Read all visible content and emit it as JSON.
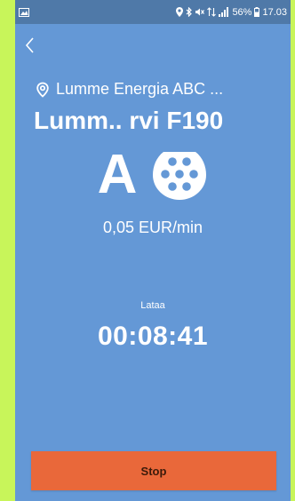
{
  "statusbar": {
    "left_icon": "image-notification-icon",
    "battery": "56%",
    "time": "17.03",
    "icons": [
      "location-icon",
      "bluetooth-icon",
      "mute-icon",
      "data-icon",
      "signal-icon",
      "battery-icon"
    ]
  },
  "header": {
    "back_icon": "chevron-left-icon",
    "location_icon": "map-pin-icon",
    "operator": "Lumme Energia ABC ...",
    "station_title": "Lumm.. rvi F190"
  },
  "connector": {
    "letter": "A",
    "type_icon": "type2-connector-icon"
  },
  "price": "0,05 EUR/min",
  "charging": {
    "status_label": "Lataa",
    "elapsed": "00:08:41"
  },
  "actions": {
    "stop_label": "Stop"
  },
  "colors": {
    "background": "#6498d6",
    "statusbar": "#4f79a8",
    "stop_button": "#e9683a",
    "frame": "#c8f55a"
  }
}
